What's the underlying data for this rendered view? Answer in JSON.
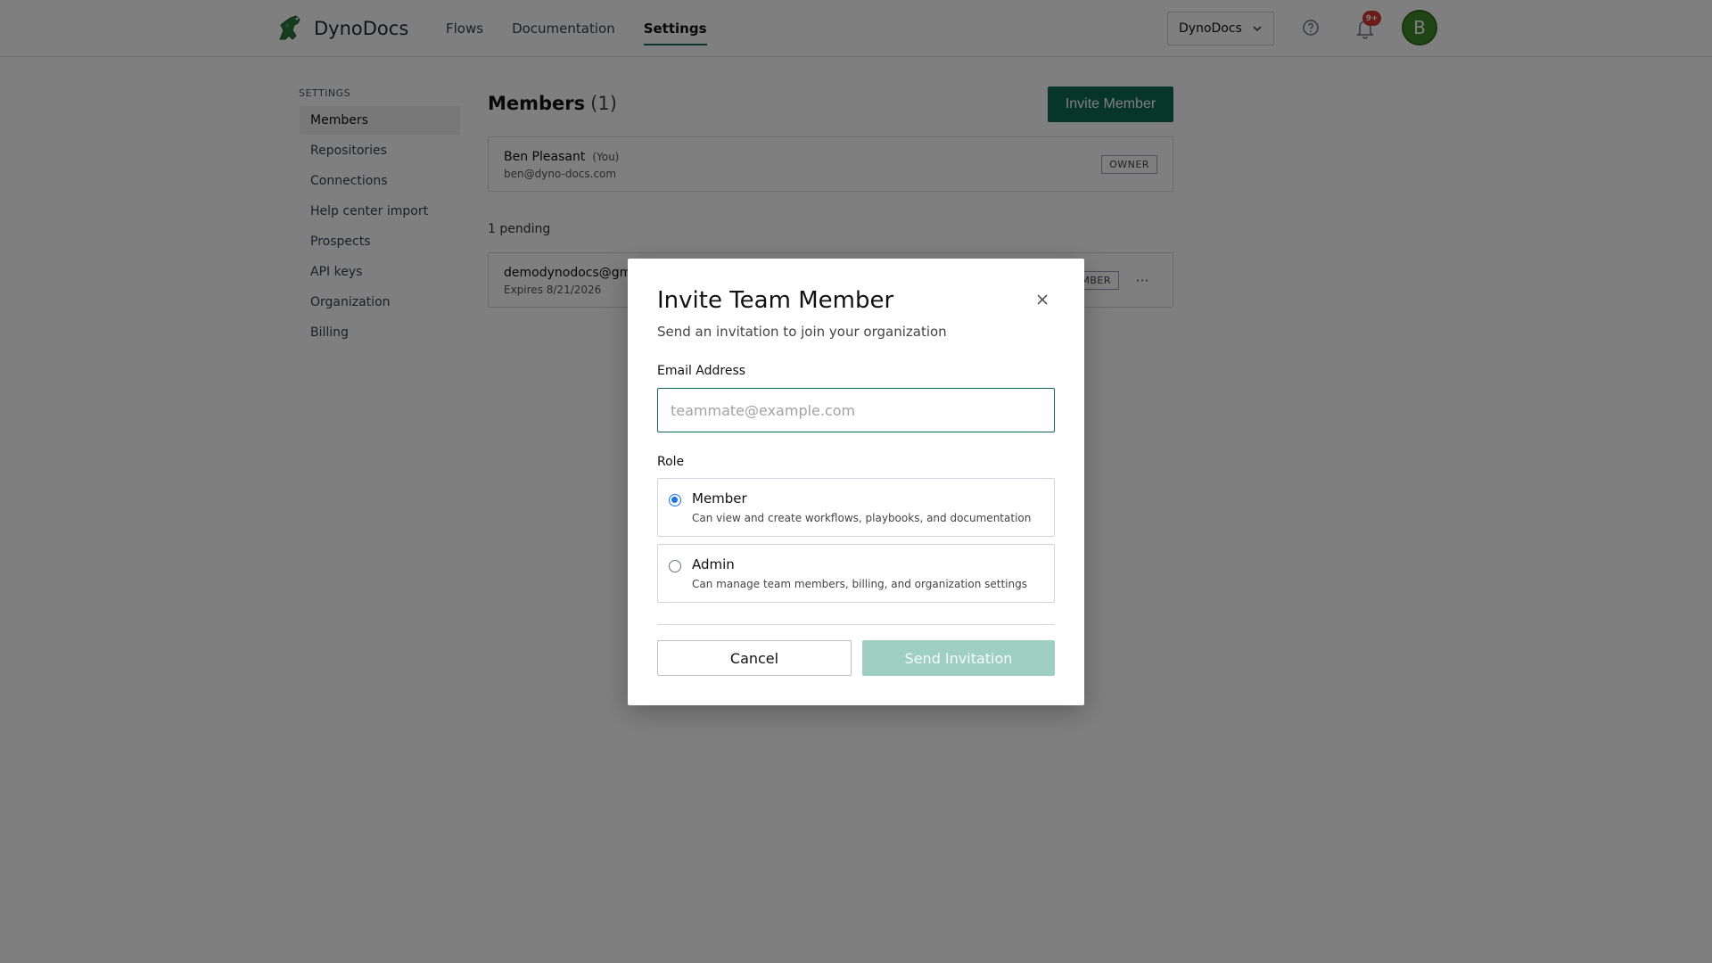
{
  "app": {
    "name": "DynoDocs"
  },
  "nav": {
    "items": [
      {
        "label": "Flows"
      },
      {
        "label": "Documentation"
      },
      {
        "label": "Settings"
      }
    ],
    "active": "Settings"
  },
  "header": {
    "org_select": "DynoDocs",
    "notification_badge": "9+",
    "avatar_initial": "B"
  },
  "sidebar": {
    "title": "SETTINGS",
    "items": [
      {
        "label": "Members"
      },
      {
        "label": "Repositories"
      },
      {
        "label": "Connections"
      },
      {
        "label": "Help center import"
      },
      {
        "label": "Prospects"
      },
      {
        "label": "API keys"
      },
      {
        "label": "Organization"
      },
      {
        "label": "Billing"
      }
    ]
  },
  "main": {
    "title": "Members",
    "count": "(1)",
    "invite_button": "Invite Member",
    "member": {
      "name": "Ben Pleasant",
      "you": "(You)",
      "email": "ben@dyno-docs.com",
      "role": "OWNER"
    },
    "pending_label": "1 pending",
    "pending": {
      "email": "demodynodocs@gm",
      "expires": "Expires 8/21/2026",
      "role": "MBER",
      "more": "···"
    }
  },
  "modal": {
    "title": "Invite Team Member",
    "subtitle": "Send an invitation to join your organization",
    "email_label": "Email Address",
    "email_placeholder": "teammate@example.com",
    "email_value": "",
    "role_label": "Role",
    "roles": [
      {
        "name": "Member",
        "description": "Can view and create workflows, playbooks, and documentation",
        "selected": true
      },
      {
        "name": "Admin",
        "description": "Can manage team members, billing, and organization settings",
        "selected": false
      }
    ],
    "cancel_label": "Cancel",
    "send_label": "Send Invitation"
  },
  "colors": {
    "brand": "#0f6b54",
    "send_disabled": "#9fcfc3",
    "badge": "#d33a2c",
    "avatar": "#3f8a2a"
  },
  "icons": {
    "logo": "dino-logo-icon",
    "org_select": "chevron-down-icon",
    "help": "help-circle-icon",
    "notifications": "bell-icon",
    "close": "close-icon",
    "more": "more-horizontal-icon"
  }
}
